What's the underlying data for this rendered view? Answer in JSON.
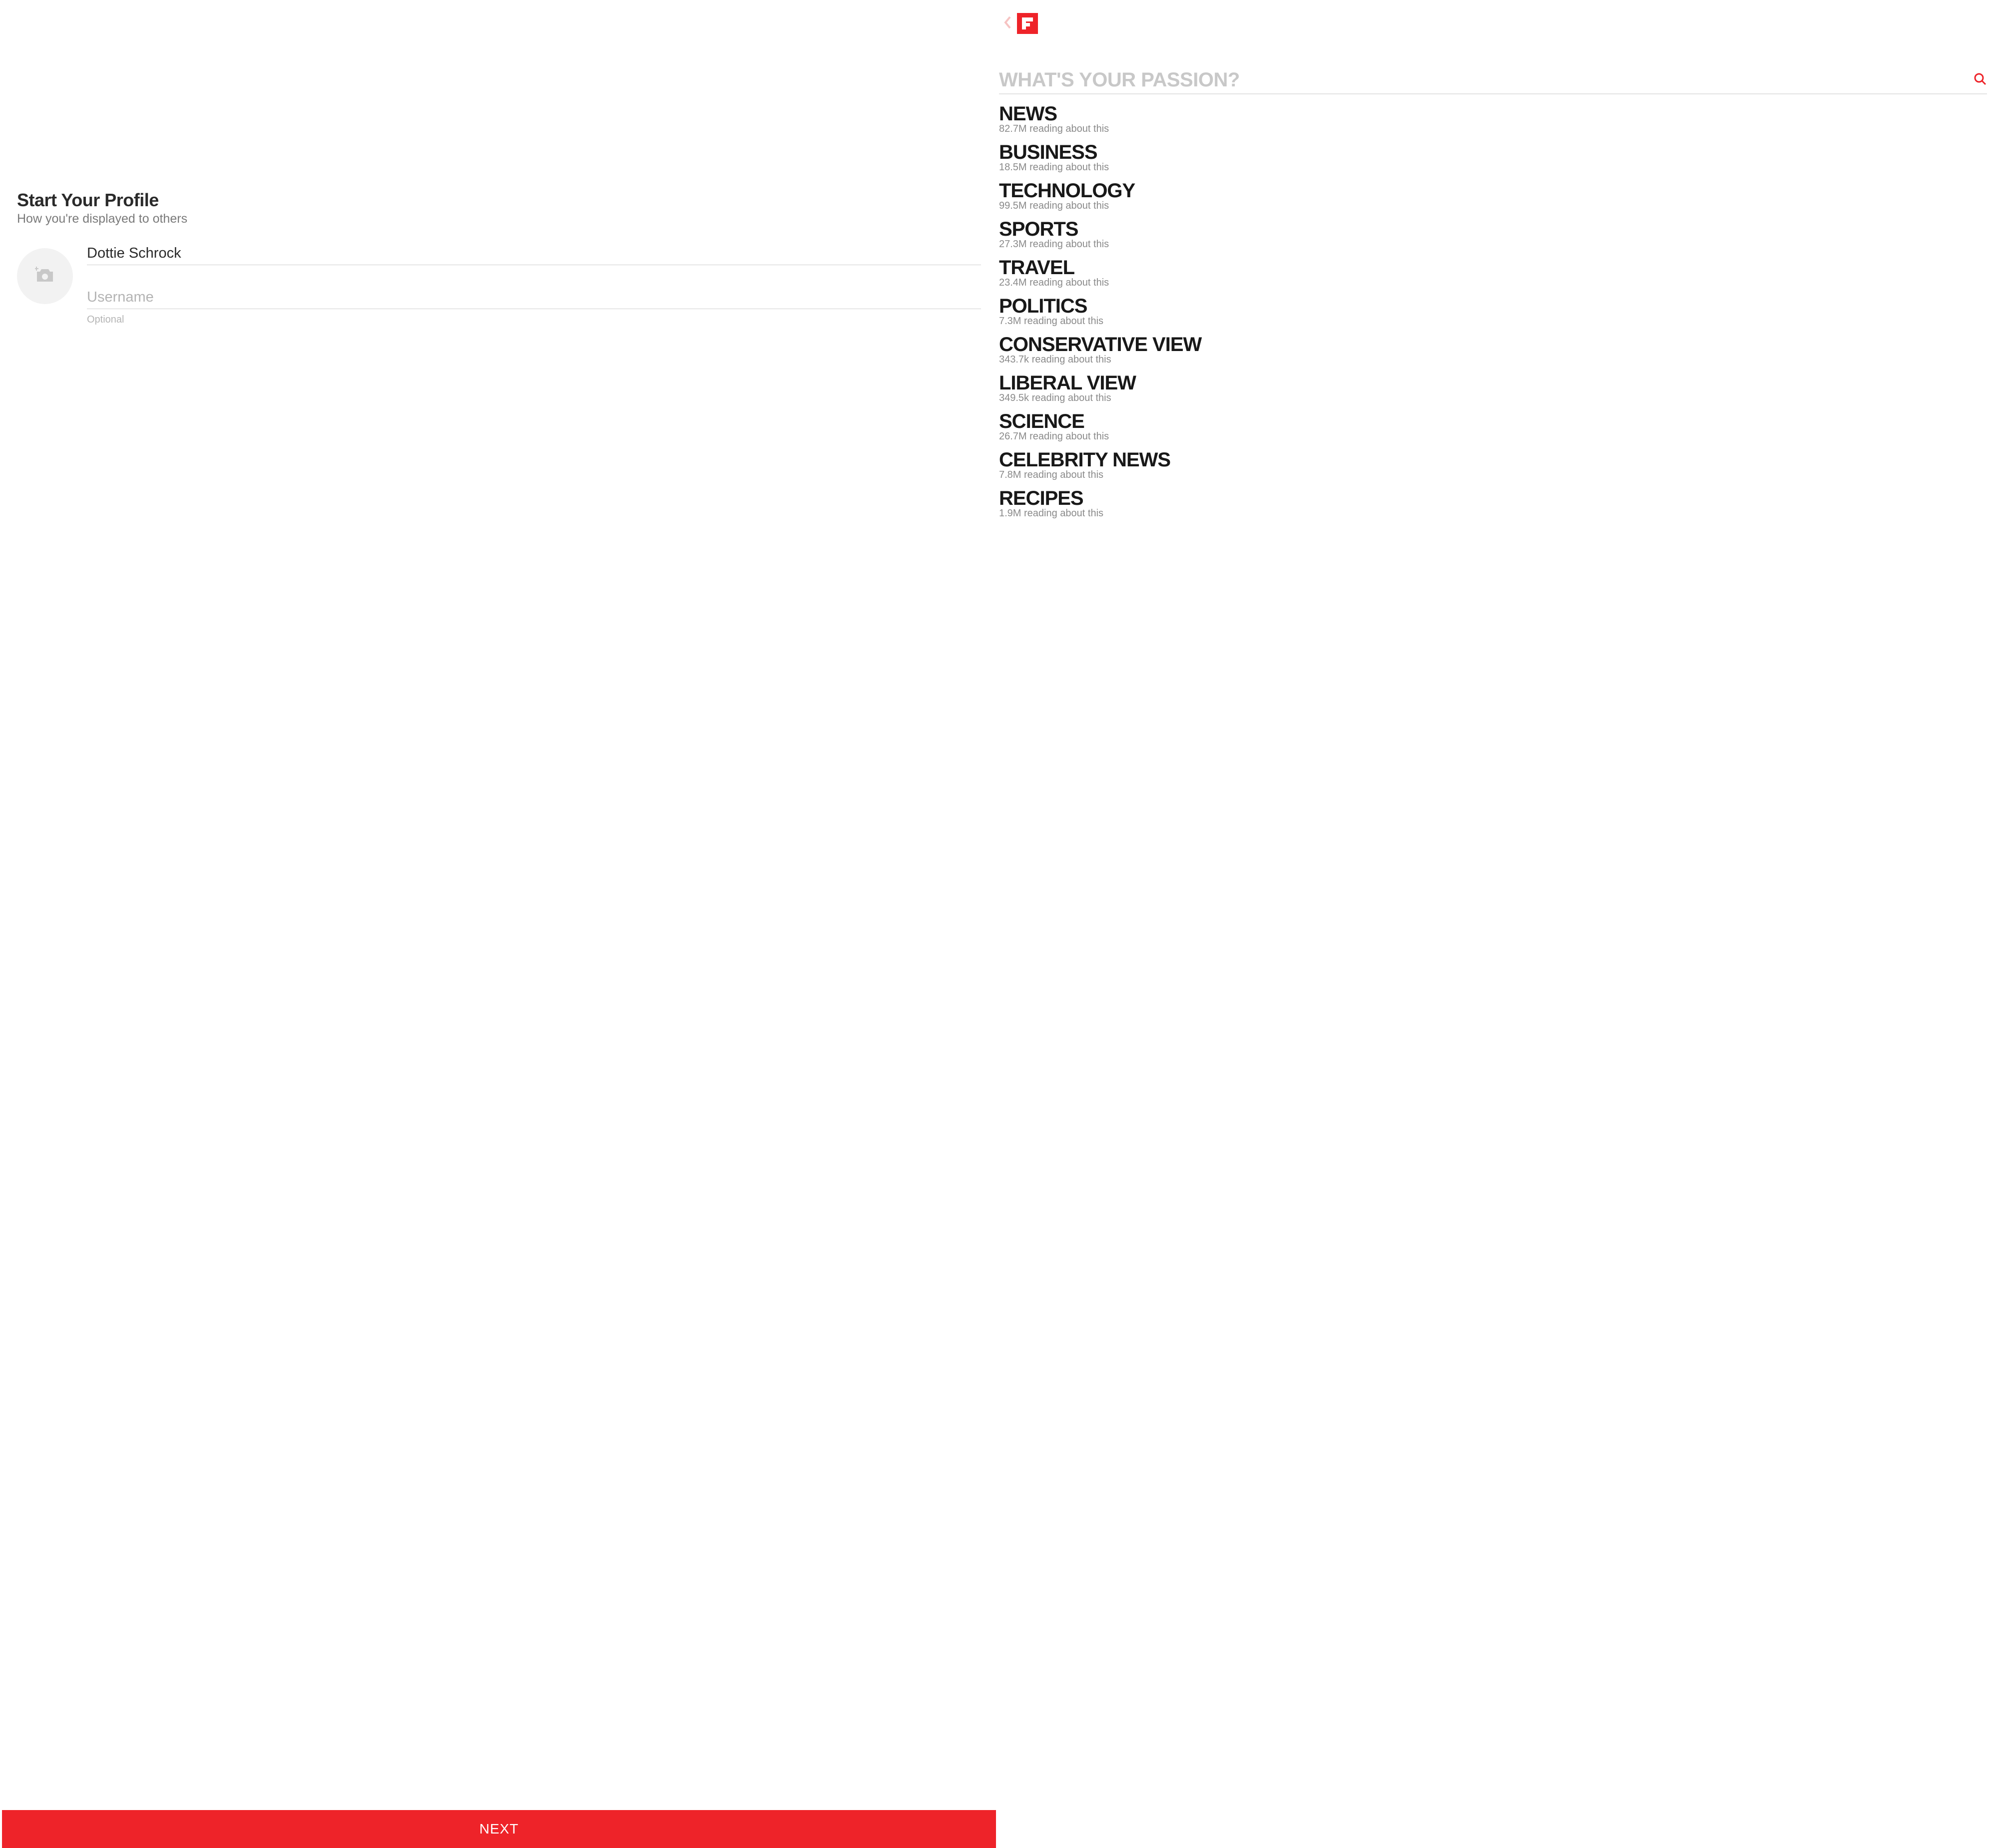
{
  "left": {
    "title": "Start Your Profile",
    "subtitle": "How you're displayed to others",
    "name_value": "Dottie Schrock",
    "username_placeholder": "Username",
    "username_helper": "Optional",
    "next_label": "NEXT"
  },
  "right": {
    "search_placeholder": "WHAT'S YOUR PASSION?",
    "topics": [
      {
        "title": "NEWS",
        "sub": "82.7M reading about this"
      },
      {
        "title": "BUSINESS",
        "sub": "18.5M reading about this"
      },
      {
        "title": "TECHNOLOGY",
        "sub": "99.5M reading about this"
      },
      {
        "title": "SPORTS",
        "sub": "27.3M reading about this"
      },
      {
        "title": "TRAVEL",
        "sub": "23.4M reading about this"
      },
      {
        "title": "POLITICS",
        "sub": "7.3M reading about this"
      },
      {
        "title": "CONSERVATIVE VIEW",
        "sub": "343.7k reading about this"
      },
      {
        "title": "LIBERAL VIEW",
        "sub": "349.5k reading about this"
      },
      {
        "title": "SCIENCE",
        "sub": "26.7M reading about this"
      },
      {
        "title": "CELEBRITY NEWS",
        "sub": "7.8M reading about this"
      },
      {
        "title": "RECIPES",
        "sub": "1.9M reading about this"
      }
    ]
  }
}
